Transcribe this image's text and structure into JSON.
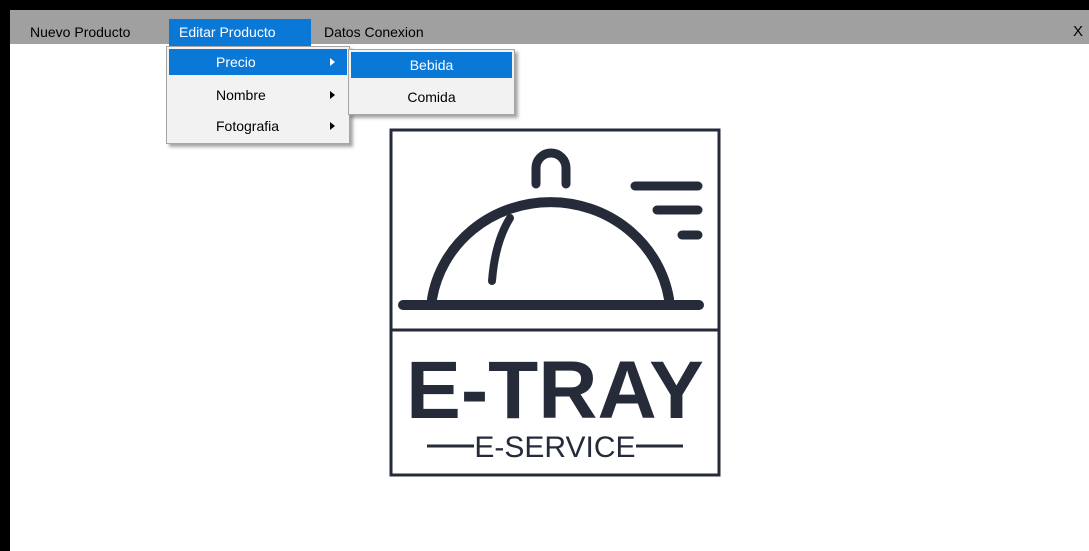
{
  "menubar": {
    "items": [
      {
        "label": "Nuevo Producto"
      },
      {
        "label": "Editar Producto"
      },
      {
        "label": "Datos Conexion"
      }
    ],
    "close_label": "X"
  },
  "editar_menu": {
    "items": [
      {
        "label": "Precio"
      },
      {
        "label": "Nombre"
      },
      {
        "label": "Fotografia"
      }
    ]
  },
  "precio_submenu": {
    "items": [
      {
        "label": "Bebida"
      },
      {
        "label": "Comida"
      }
    ]
  },
  "logo": {
    "title": "E-TRAY",
    "subtitle": "E-SERVICE",
    "color": "#262b3a"
  },
  "colors": {
    "menubar": "#a0a0a0",
    "highlight": "#0a78d7",
    "dropdown": "#f2f2f2"
  }
}
